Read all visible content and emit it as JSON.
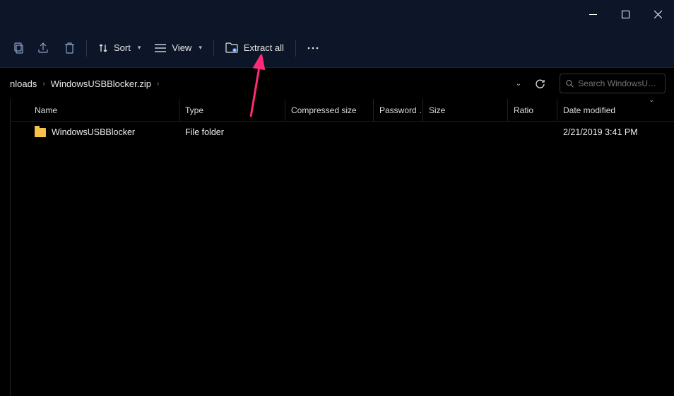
{
  "titlebar": {
    "min": "—",
    "max": "▢",
    "close": "✕"
  },
  "toolbar": {
    "sort_label": "Sort",
    "view_label": "View",
    "extract_label": "Extract all",
    "more": "⋯"
  },
  "address": {
    "crumbs": [
      "nloads",
      "WindowsUSBBlocker.zip"
    ],
    "search_placeholder": "Search WindowsU…"
  },
  "columns": {
    "name": "Name",
    "type": "Type",
    "csize": "Compressed size",
    "pwd": "Password …",
    "size": "Size",
    "ratio": "Ratio",
    "date": "Date modified"
  },
  "rows": [
    {
      "name": "WindowsUSBBlocker",
      "type": "File folder",
      "csize": "",
      "pwd": "",
      "size": "",
      "ratio": "",
      "date": "2/21/2019 3:41 PM"
    }
  ],
  "colors": {
    "accent": "#ff2a78"
  }
}
